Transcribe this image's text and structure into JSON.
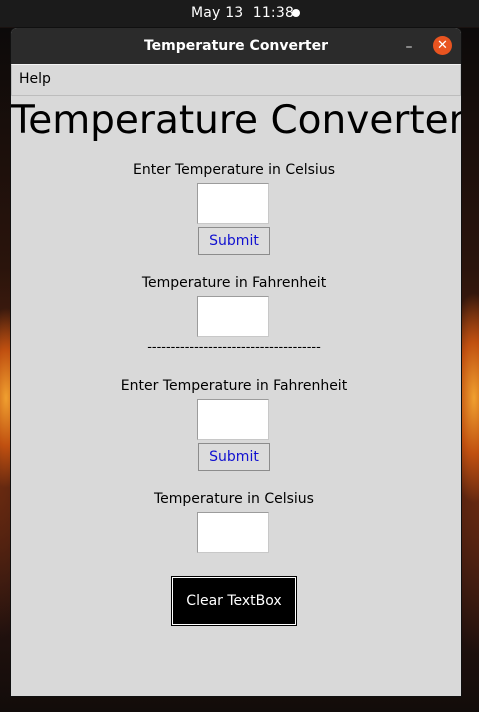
{
  "system_bar": {
    "clock": "May 13  11:38"
  },
  "window": {
    "title": "Temperature Converter",
    "minimize_glyph": "–",
    "close_glyph": "✕"
  },
  "menubar": {
    "items": [
      {
        "label": "Help"
      }
    ]
  },
  "app": {
    "heading": "Temperature Converter",
    "celsius_section": {
      "input_label": "Enter Temperature in Celsius",
      "input_value": "",
      "submit_label": "Submit",
      "output_label": "Temperature in Fahrenheit",
      "output_value": ""
    },
    "divider": "-------------------------------------",
    "fahrenheit_section": {
      "input_label": "Enter Temperature in Fahrenheit",
      "input_value": "",
      "submit_label": "Submit",
      "output_label": "Temperature in Celsius",
      "output_value": ""
    },
    "clear_label": "Clear TextBox"
  },
  "colors": {
    "window_bg": "#d9d9d9",
    "titlebar_bg": "#2b2b2b",
    "close_button": "#e95420",
    "submit_text": "#1010d0",
    "clear_button_bg": "#000000"
  }
}
